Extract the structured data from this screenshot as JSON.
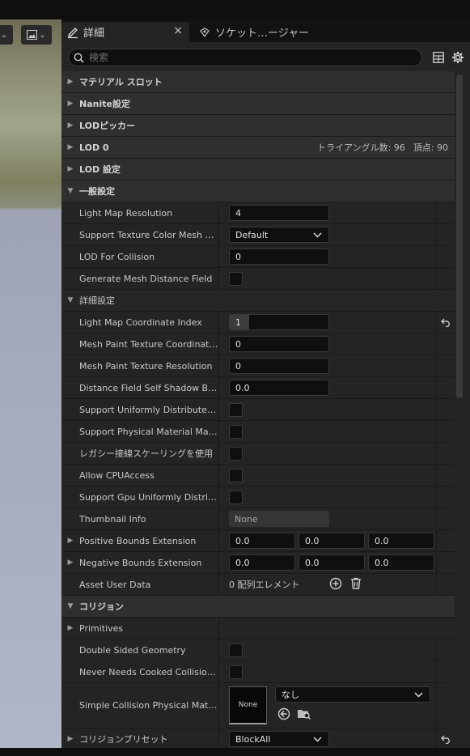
{
  "viewport": {
    "toolbar_a": "⌄",
    "toolbar_b": "⌄"
  },
  "tabs": [
    {
      "label": "詳細",
      "close": "×"
    },
    {
      "label": "ソケット…ージャー"
    }
  ],
  "search": {
    "placeholder": "検索"
  },
  "categories": {
    "material_slots": "マテリアル スロット",
    "nanite": "Nanite設定",
    "lod_picker": "LODピッカー",
    "lod0": "LOD 0",
    "lod0_triangles": "トライアングル数: 96",
    "lod0_vertices": "頂点: 90",
    "lod_settings": "LOD 設定",
    "general": "一般設定",
    "advanced": "詳細設定",
    "collision": "コリジョン"
  },
  "props": {
    "light_map_resolution": {
      "label": "Light Map Resolution",
      "value": "4"
    },
    "support_texture_color": {
      "label": "Support Texture Color Mesh Painting",
      "value": "Default"
    },
    "lod_for_collision": {
      "label": "LOD For Collision",
      "value": "0"
    },
    "generate_mesh_distance": {
      "label": "Generate Mesh Distance Field"
    },
    "light_map_coord_index": {
      "label": "Light Map Coordinate Index",
      "value": "1",
      "fill": 0.2
    },
    "mesh_paint_coord_index": {
      "label": "Mesh Paint Texture Coordinate Index",
      "value": "0"
    },
    "mesh_paint_resolution": {
      "label": "Mesh Paint Texture Resolution",
      "value": "0"
    },
    "distance_field_bias": {
      "label": "Distance Field Self Shadow Bias",
      "value": "0.0"
    },
    "support_uniform_dist": {
      "label": "Support Uniformly Distributed Sampling"
    },
    "support_physical_masks": {
      "label": "Support Physical Material Masks"
    },
    "legacy_tangent": {
      "label": "レガシー接線スケーリングを使用"
    },
    "allow_cpu_access": {
      "label": "Allow CPUAccess"
    },
    "support_gpu_uniform": {
      "label": "Support Gpu Uniformly Distributed Sampling"
    },
    "thumbnail_info": {
      "label": "Thumbnail Info",
      "value": "None"
    },
    "positive_bounds": {
      "label": "Positive Bounds Extension",
      "x": "0.0",
      "y": "0.0",
      "z": "0.0"
    },
    "negative_bounds": {
      "label": "Negative Bounds Extension",
      "x": "0.0",
      "y": "0.0",
      "z": "0.0"
    },
    "asset_user_data": {
      "label": "Asset User Data",
      "value": "0 配列エレメント"
    },
    "primitives": {
      "label": "Primitives"
    },
    "double_sided": {
      "label": "Double Sided Geometry"
    },
    "never_cooked": {
      "label": "Never Needs Cooked Collision Data"
    },
    "simple_collision_mat": {
      "label": "Simple Collision Physical Material",
      "thumb": "None",
      "value": "なし"
    },
    "collision_preset": {
      "label": "コリジョンプリセット",
      "value": "BlockAll"
    }
  }
}
